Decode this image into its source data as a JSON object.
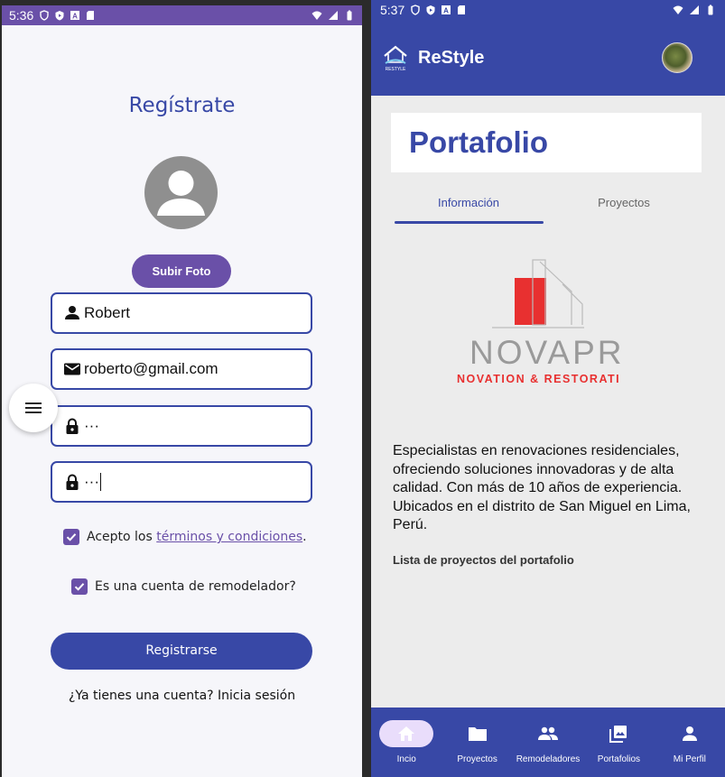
{
  "left_phone": {
    "status_bar": {
      "time": "5:36"
    },
    "title": "Regístrate",
    "upload_button": "Subir Foto",
    "fields": {
      "name": "Robert",
      "email": "roberto@gmail.com",
      "password": "···",
      "confirm_password": "···"
    },
    "terms": {
      "prefix": "Acepto los ",
      "link": "términos y condiciones",
      "suffix": ".",
      "checked": true
    },
    "remodeler": {
      "label": "Es una cuenta de remodelador?",
      "checked": true
    },
    "register_button": "Registrarse",
    "login_prompt": "¿Ya tienes una cuenta? Inicia sesión",
    "colors": {
      "primary": "#3848a6",
      "accent": "#6a50a8",
      "background": "#f6f6fa"
    }
  },
  "right_phone": {
    "status_bar": {
      "time": "5:37"
    },
    "app_name": "ReStyle",
    "logo_caption": "RESTYLE",
    "page_title": "Portafolio",
    "tabs": [
      {
        "label": "Información",
        "active": true
      },
      {
        "label": "Proyectos",
        "active": false
      }
    ],
    "company_logo": {
      "name": "NOVAPR",
      "tagline": "NOVATION & RESTORATI"
    },
    "description": "Especialistas en renovaciones residenciales, ofreciendo soluciones innovadoras y de alta calidad. Con más de 10 años de experiencia. Ubicados en el distrito de San Miguel en Lima, Perú.",
    "projects_list_label": "Lista de proyectos del portafolio",
    "bottom_nav": [
      {
        "label": "Incio",
        "icon": "home-icon",
        "active": true
      },
      {
        "label": "Proyectos",
        "icon": "folder-icon",
        "active": false
      },
      {
        "label": "Remodeladores",
        "icon": "people-icon",
        "active": false
      },
      {
        "label": "Portafolios",
        "icon": "gallery-icon",
        "active": false
      },
      {
        "label": "Mi Perfil",
        "icon": "person-icon",
        "active": false
      }
    ],
    "colors": {
      "primary": "#3848a6",
      "nav_active_pill": "#e9ddfb",
      "logo_red": "#e83030"
    }
  }
}
